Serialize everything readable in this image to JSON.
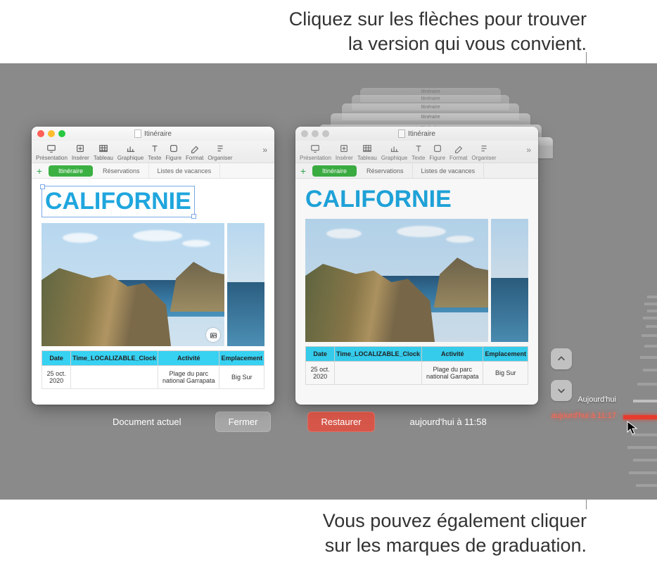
{
  "annotations": {
    "top": "Cliquez sur les flèches pour trouver\nla version qui vous convient.",
    "bottom": "Vous pouvez également cliquer\nsur les marques de graduation."
  },
  "stack_titles": [
    "Itinéraire",
    "Itinéraire",
    "Itinéraire",
    "Itinéraire",
    "Itinéraire",
    "Itinéraire"
  ],
  "window": {
    "title": "Itinéraire",
    "toolbar": [
      "Présentation",
      "Insérer",
      "Tableau",
      "Graphique",
      "Texte",
      "Figure",
      "Format",
      "Organiser"
    ],
    "tabs": [
      "Itinéraire",
      "Réservations",
      "Listes de vacances"
    ],
    "heading": "CALIFORNIE",
    "table": {
      "headers": [
        "Date",
        "Time_LOCALIZABLE_Clock",
        "Activité",
        "Emplacement"
      ],
      "rows": [
        [
          "25 oct. 2020",
          "",
          "Plage du parc national Garrapata",
          "Big Sur"
        ]
      ]
    }
  },
  "controls": {
    "current_label": "Document actuel",
    "close": "Fermer",
    "restore": "Restaurer",
    "timestamp": "aujourd'hui à 11:58"
  },
  "timeline": {
    "today_label": "Aujourd'hui",
    "current_label": "aujourd'hui à 11:17"
  }
}
